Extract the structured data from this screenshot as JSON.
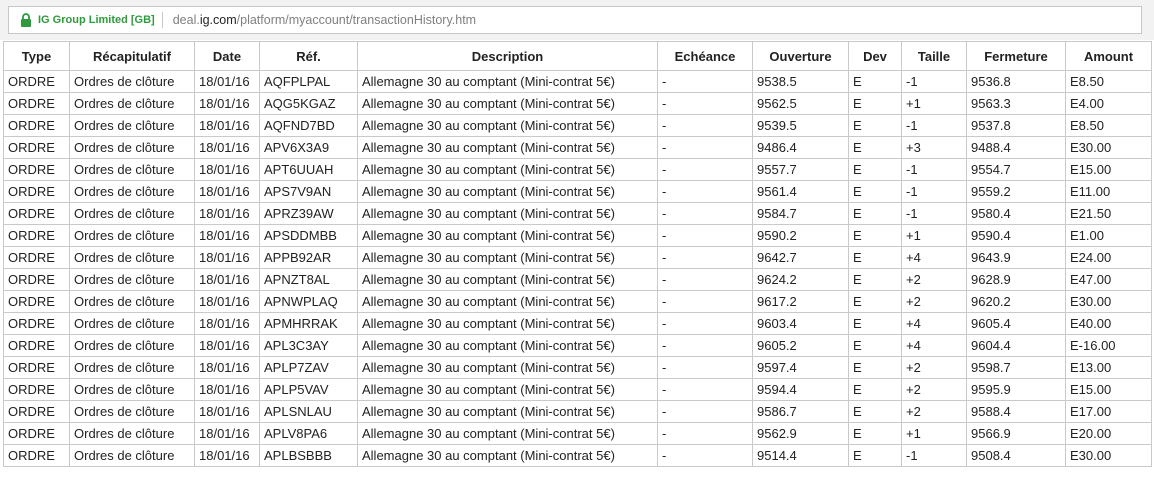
{
  "browser": {
    "site_identity": "IG Group Limited [GB]",
    "url_prefix": "deal.",
    "url_host": "ig.com",
    "url_path": "/platform/myaccount/transactionHistory.htm",
    "identity_color": "#2e9a3f"
  },
  "table": {
    "columns": [
      "Type",
      "Récapitulatif",
      "Date",
      "Réf.",
      "Description",
      "Echéance",
      "Ouverture",
      "Dev",
      "Taille",
      "Fermeture",
      "Amount"
    ],
    "rows": [
      [
        "ORDRE",
        "Ordres de clôture",
        "18/01/16",
        "AQFPLPAL",
        "Allemagne 30 au comptant (Mini-contrat 5€)",
        "-",
        "9538.5",
        "E",
        "-1",
        "9536.8",
        "E8.50"
      ],
      [
        "ORDRE",
        "Ordres de clôture",
        "18/01/16",
        "AQG5KGAZ",
        "Allemagne 30 au comptant (Mini-contrat 5€)",
        "-",
        "9562.5",
        "E",
        "+1",
        "9563.3",
        "E4.00"
      ],
      [
        "ORDRE",
        "Ordres de clôture",
        "18/01/16",
        "AQFND7BD",
        "Allemagne 30 au comptant (Mini-contrat 5€)",
        "-",
        "9539.5",
        "E",
        "-1",
        "9537.8",
        "E8.50"
      ],
      [
        "ORDRE",
        "Ordres de clôture",
        "18/01/16",
        "APV6X3A9",
        "Allemagne 30 au comptant (Mini-contrat 5€)",
        "-",
        "9486.4",
        "E",
        "+3",
        "9488.4",
        "E30.00"
      ],
      [
        "ORDRE",
        "Ordres de clôture",
        "18/01/16",
        "APT6UUAH",
        "Allemagne 30 au comptant (Mini-contrat 5€)",
        "-",
        "9557.7",
        "E",
        "-1",
        "9554.7",
        "E15.00"
      ],
      [
        "ORDRE",
        "Ordres de clôture",
        "18/01/16",
        "APS7V9AN",
        "Allemagne 30 au comptant (Mini-contrat 5€)",
        "-",
        "9561.4",
        "E",
        "-1",
        "9559.2",
        "E11.00"
      ],
      [
        "ORDRE",
        "Ordres de clôture",
        "18/01/16",
        "APRZ39AW",
        "Allemagne 30 au comptant (Mini-contrat 5€)",
        "-",
        "9584.7",
        "E",
        "-1",
        "9580.4",
        "E21.50"
      ],
      [
        "ORDRE",
        "Ordres de clôture",
        "18/01/16",
        "APSDDMBB",
        "Allemagne 30 au comptant (Mini-contrat 5€)",
        "-",
        "9590.2",
        "E",
        "+1",
        "9590.4",
        "E1.00"
      ],
      [
        "ORDRE",
        "Ordres de clôture",
        "18/01/16",
        "APPB92AR",
        "Allemagne 30 au comptant (Mini-contrat 5€)",
        "-",
        "9642.7",
        "E",
        "+4",
        "9643.9",
        "E24.00"
      ],
      [
        "ORDRE",
        "Ordres de clôture",
        "18/01/16",
        "APNZT8AL",
        "Allemagne 30 au comptant (Mini-contrat 5€)",
        "-",
        "9624.2",
        "E",
        "+2",
        "9628.9",
        "E47.00"
      ],
      [
        "ORDRE",
        "Ordres de clôture",
        "18/01/16",
        "APNWPLAQ",
        "Allemagne 30 au comptant (Mini-contrat 5€)",
        "-",
        "9617.2",
        "E",
        "+2",
        "9620.2",
        "E30.00"
      ],
      [
        "ORDRE",
        "Ordres de clôture",
        "18/01/16",
        "APMHRRAK",
        "Allemagne 30 au comptant (Mini-contrat 5€)",
        "-",
        "9603.4",
        "E",
        "+4",
        "9605.4",
        "E40.00"
      ],
      [
        "ORDRE",
        "Ordres de clôture",
        "18/01/16",
        "APL3C3AY",
        "Allemagne 30 au comptant (Mini-contrat 5€)",
        "-",
        "9605.2",
        "E",
        "+4",
        "9604.4",
        "E-16.00"
      ],
      [
        "ORDRE",
        "Ordres de clôture",
        "18/01/16",
        "APLP7ZAV",
        "Allemagne 30 au comptant (Mini-contrat 5€)",
        "-",
        "9597.4",
        "E",
        "+2",
        "9598.7",
        "E13.00"
      ],
      [
        "ORDRE",
        "Ordres de clôture",
        "18/01/16",
        "APLP5VAV",
        "Allemagne 30 au comptant (Mini-contrat 5€)",
        "-",
        "9594.4",
        "E",
        "+2",
        "9595.9",
        "E15.00"
      ],
      [
        "ORDRE",
        "Ordres de clôture",
        "18/01/16",
        "APLSNLAU",
        "Allemagne 30 au comptant (Mini-contrat 5€)",
        "-",
        "9586.7",
        "E",
        "+2",
        "9588.4",
        "E17.00"
      ],
      [
        "ORDRE",
        "Ordres de clôture",
        "18/01/16",
        "APLV8PA6",
        "Allemagne 30 au comptant (Mini-contrat 5€)",
        "-",
        "9562.9",
        "E",
        "+1",
        "9566.9",
        "E20.00"
      ],
      [
        "ORDRE",
        "Ordres de clôture",
        "18/01/16",
        "APLBSBBB",
        "Allemagne 30 au comptant (Mini-contrat 5€)",
        "-",
        "9514.4",
        "E",
        "-1",
        "9508.4",
        "E30.00"
      ]
    ]
  }
}
